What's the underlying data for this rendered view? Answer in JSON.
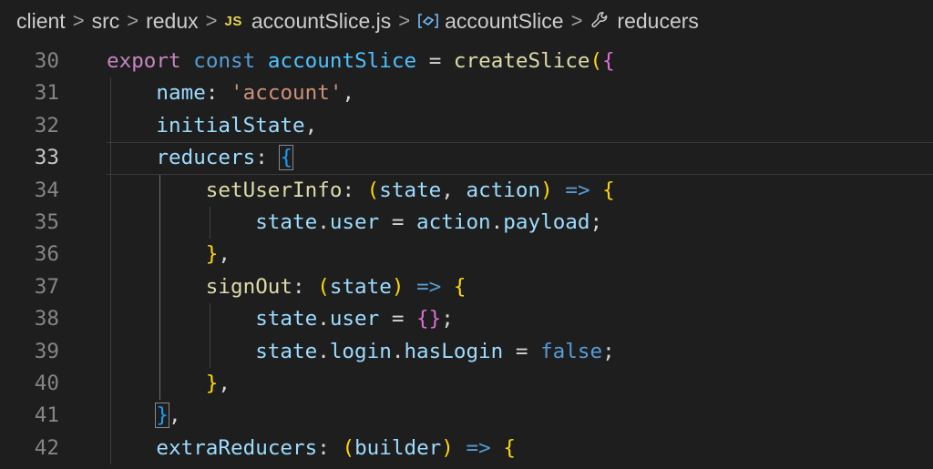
{
  "breadcrumb": {
    "items": [
      "client",
      "src",
      "redux",
      "accountSlice.js",
      "accountSlice",
      "reducers"
    ],
    "js_badge": "JS",
    "separator": ">"
  },
  "editor": {
    "current_line": 33,
    "lines": [
      {
        "n": "30",
        "tokens": [
          [
            "kw",
            "export"
          ],
          [
            "op",
            " "
          ],
          [
            "st",
            "const"
          ],
          [
            "op",
            " "
          ],
          [
            "var",
            "accountSlice"
          ],
          [
            "op",
            " = "
          ],
          [
            "fn",
            "createSlice"
          ],
          [
            "p1",
            "("
          ],
          [
            "p2",
            "{"
          ]
        ]
      },
      {
        "n": "31",
        "tokens": [
          [
            "prop",
            "name"
          ],
          [
            "op",
            ": "
          ],
          [
            "str",
            "'account'"
          ],
          [
            "op",
            ","
          ]
        ]
      },
      {
        "n": "32",
        "tokens": [
          [
            "prop",
            "initialState"
          ],
          [
            "op",
            ","
          ]
        ]
      },
      {
        "n": "33",
        "tokens": [
          [
            "prop",
            "reducers"
          ],
          [
            "op",
            ": "
          ],
          [
            "p3",
            "{"
          ]
        ]
      },
      {
        "n": "34",
        "tokens": [
          [
            "fn",
            "setUserInfo"
          ],
          [
            "op",
            ": "
          ],
          [
            "p1",
            "("
          ],
          [
            "prop",
            "state"
          ],
          [
            "op",
            ", "
          ],
          [
            "prop",
            "action"
          ],
          [
            "p1",
            ")"
          ],
          [
            "op",
            " "
          ],
          [
            "arrow",
            "=>"
          ],
          [
            "op",
            " "
          ],
          [
            "p1",
            "{"
          ]
        ]
      },
      {
        "n": "35",
        "tokens": [
          [
            "prop",
            "state"
          ],
          [
            "op",
            "."
          ],
          [
            "prop",
            "user"
          ],
          [
            "op",
            " = "
          ],
          [
            "prop",
            "action"
          ],
          [
            "op",
            "."
          ],
          [
            "prop",
            "payload"
          ],
          [
            "op",
            ";"
          ]
        ]
      },
      {
        "n": "36",
        "tokens": [
          [
            "p1",
            "}"
          ],
          [
            "op",
            ","
          ]
        ]
      },
      {
        "n": "37",
        "tokens": [
          [
            "fn",
            "signOut"
          ],
          [
            "op",
            ": "
          ],
          [
            "p1",
            "("
          ],
          [
            "prop",
            "state"
          ],
          [
            "p1",
            ")"
          ],
          [
            "op",
            " "
          ],
          [
            "arrow",
            "=>"
          ],
          [
            "op",
            " "
          ],
          [
            "p1",
            "{"
          ]
        ]
      },
      {
        "n": "38",
        "tokens": [
          [
            "prop",
            "state"
          ],
          [
            "op",
            "."
          ],
          [
            "prop",
            "user"
          ],
          [
            "op",
            " = "
          ],
          [
            "p2",
            "{}"
          ],
          [
            "op",
            ";"
          ]
        ]
      },
      {
        "n": "39",
        "tokens": [
          [
            "prop",
            "state"
          ],
          [
            "op",
            "."
          ],
          [
            "prop",
            "login"
          ],
          [
            "op",
            "."
          ],
          [
            "prop",
            "hasLogin"
          ],
          [
            "op",
            " = "
          ],
          [
            "lit",
            "false"
          ],
          [
            "op",
            ";"
          ]
        ]
      },
      {
        "n": "40",
        "tokens": [
          [
            "p1",
            "}"
          ],
          [
            "op",
            ","
          ]
        ]
      },
      {
        "n": "41",
        "tokens": [
          [
            "p3",
            "}"
          ],
          [
            "op",
            ","
          ]
        ]
      },
      {
        "n": "42",
        "tokens": [
          [
            "prop",
            "extraReducers"
          ],
          [
            "op",
            ": "
          ],
          [
            "p1",
            "("
          ],
          [
            "prop",
            "builder"
          ],
          [
            "p1",
            ")"
          ],
          [
            "op",
            " "
          ],
          [
            "arrow",
            "=>"
          ],
          [
            "op",
            " "
          ],
          [
            "p1",
            "{"
          ]
        ]
      }
    ]
  }
}
